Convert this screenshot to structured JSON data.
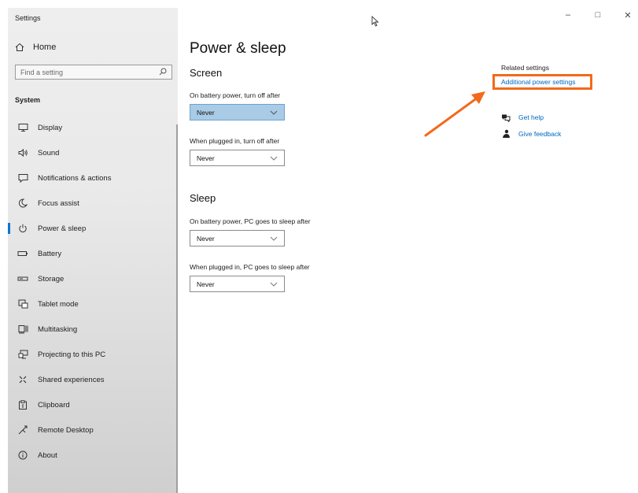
{
  "window": {
    "title": "Settings"
  },
  "sidebar": {
    "home_label": "Home",
    "search": {
      "placeholder": "Find a setting"
    },
    "section_label": "System",
    "items": [
      {
        "label": "Display",
        "icon": "monitor-icon"
      },
      {
        "label": "Sound",
        "icon": "speaker-icon"
      },
      {
        "label": "Notifications & actions",
        "icon": "notification-icon"
      },
      {
        "label": "Focus assist",
        "icon": "moon-icon"
      },
      {
        "label": "Power & sleep",
        "icon": "power-icon",
        "active": true
      },
      {
        "label": "Battery",
        "icon": "battery-icon"
      },
      {
        "label": "Storage",
        "icon": "storage-icon"
      },
      {
        "label": "Tablet mode",
        "icon": "tablet-icon"
      },
      {
        "label": "Multitasking",
        "icon": "multitasking-icon"
      },
      {
        "label": "Projecting to this PC",
        "icon": "projecting-icon"
      },
      {
        "label": "Shared experiences",
        "icon": "shared-icon"
      },
      {
        "label": "Clipboard",
        "icon": "clipboard-icon"
      },
      {
        "label": "Remote Desktop",
        "icon": "remote-desktop-icon"
      },
      {
        "label": "About",
        "icon": "info-icon"
      }
    ]
  },
  "main": {
    "title": "Power & sleep",
    "screen": {
      "heading": "Screen",
      "battery_label": "On battery power, turn off after",
      "battery_value": "Never",
      "plugged_label": "When plugged in, turn off after",
      "plugged_value": "Never"
    },
    "sleep": {
      "heading": "Sleep",
      "battery_label": "On battery power, PC goes to sleep after",
      "battery_value": "Never",
      "plugged_label": "When plugged in, PC goes to sleep after",
      "plugged_value": "Never"
    }
  },
  "related": {
    "heading": "Related settings",
    "additional_power_link": "Additional power settings",
    "get_help": "Get help",
    "give_feedback": "Give feedback"
  },
  "colors": {
    "accent": "#0078d4",
    "link": "#0067c0",
    "annotation": "#f26a1b",
    "focused_dropdown": "#a9cbe6"
  }
}
